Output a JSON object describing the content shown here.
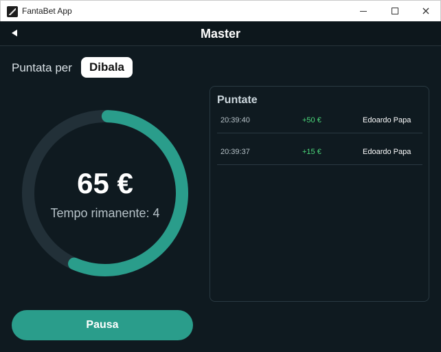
{
  "window": {
    "title": "FantaBet App",
    "icon": "gavel-app-icon",
    "controls": {
      "minimize": "minimize-icon",
      "maximize": "maximize-icon",
      "close": "×"
    }
  },
  "header": {
    "back_icon": "back-arrow-icon",
    "title": "Master"
  },
  "bet_for": {
    "label": "Puntata per",
    "player": "Dibala"
  },
  "timer": {
    "amount": "65 €",
    "remaining_text": "Tempo rimanente: 4",
    "progress": 0.56,
    "ring_color": "#2a9d8b",
    "track_color": "#223038"
  },
  "bets_panel": {
    "title": "Puntate",
    "rows": [
      {
        "time": "20:39:40",
        "delta": "+50 €",
        "user": "Edoardo Papa"
      },
      {
        "time": "20:39:37",
        "delta": "+15 €",
        "user": "Edoardo Papa"
      }
    ]
  },
  "actions": {
    "pause_label": "Pausa"
  },
  "colors": {
    "accent": "#2a9d8b",
    "positive": "#4cd97b",
    "background": "#0f1a20"
  }
}
